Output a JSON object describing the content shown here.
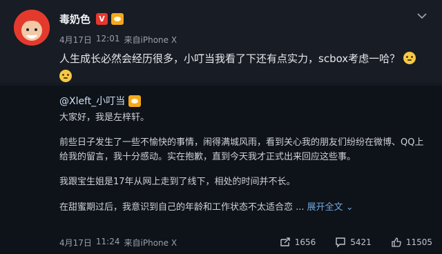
{
  "post": {
    "author": "毒奶色",
    "vip_badge": "V",
    "date": "4月17日",
    "time": "12:01",
    "source_prefix": "来自",
    "source": "iPhone X",
    "text": "人生成长必然会经历很多，小叮当我看了下还有点实力，scbox考虑一哈？"
  },
  "repost": {
    "author": "@Xleft_小叮当",
    "paragraphs": [
      "大家好，我是左梓轩。",
      "前些日子发生了一些不愉快的事情，闹得满城风雨，看到关心我的朋友们纷纷在微博、QQ上给我的留言，我十分感动。实在抱歉，直到今天我才正式出来回应这些事。",
      "我跟宝生姐是17年从网上走到了线下，相处的时间并不长。",
      "在甜蜜期过后，我意识到自己的年龄和工作状态不太适合恋 ..."
    ],
    "expand_label": "展开全文",
    "date": "4月17日",
    "time": "11:24",
    "source_prefix": "来自",
    "source": "iPhone X",
    "repost_count": "1656",
    "comment_count": "5421",
    "like_count": "11505"
  },
  "icons": {
    "chevron": "chevron-down-icon",
    "repost": "repost-icon",
    "comment": "comment-icon",
    "like": "like-icon",
    "emoji": "dizzy-face-emoji-icon"
  },
  "colors": {
    "background": "#151a22",
    "repost_background": "#0e1219",
    "vip_red": "#e8372d",
    "link_blue": "#6fa8dc"
  }
}
